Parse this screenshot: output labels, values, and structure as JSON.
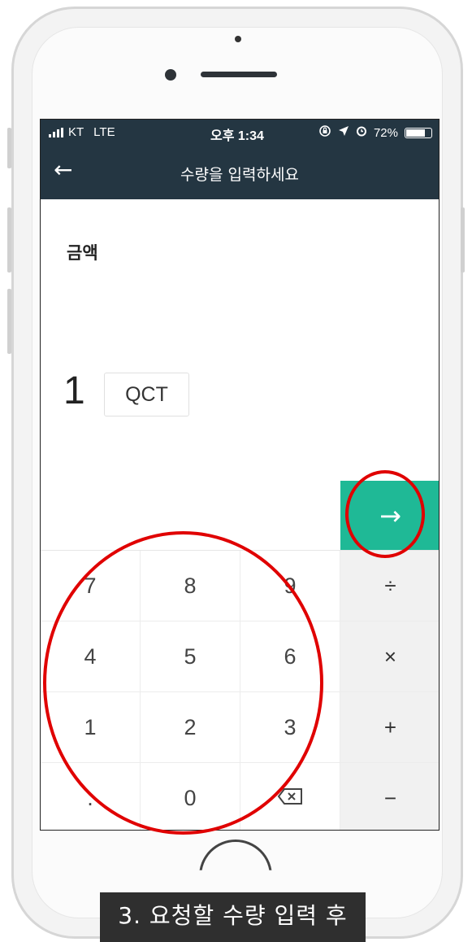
{
  "status_bar": {
    "carrier": "KT",
    "network": "LTE",
    "time": "오후 1:34",
    "icons": [
      "lock-rotation-icon",
      "location-arrow-icon",
      "alarm-icon"
    ],
    "battery": "72%",
    "battery_level": 0.72
  },
  "app_bar": {
    "back_icon": "←",
    "title": "수량을 입력하세요"
  },
  "form": {
    "label": "금액",
    "amount": "1",
    "currency": "QCT"
  },
  "go_button": {
    "icon": "→"
  },
  "keypad": {
    "rows": [
      [
        "7",
        "8",
        "9"
      ],
      [
        "4",
        "5",
        "6"
      ],
      [
        "1",
        "2",
        "3"
      ],
      [
        ".",
        "0",
        ""
      ]
    ],
    "operators": [
      "÷",
      "×",
      "+",
      "−"
    ]
  },
  "caption": {
    "line1": "3. 요청할 수량 입력 후"
  },
  "colors": {
    "header_bg": "#243642",
    "accent": "#1fb996",
    "annotation": "#e00000"
  }
}
